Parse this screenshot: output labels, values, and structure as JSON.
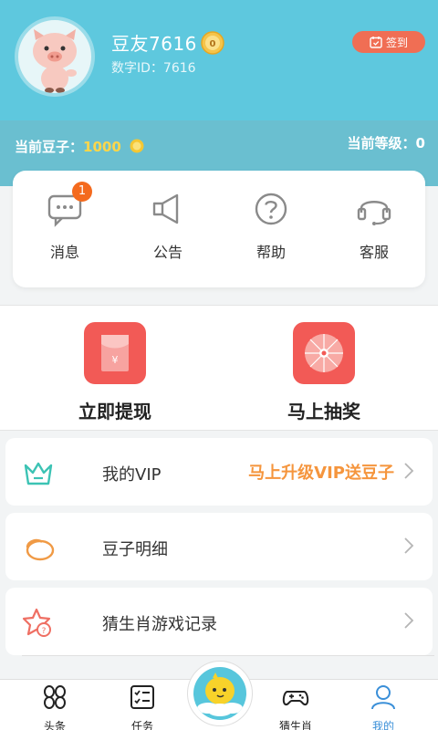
{
  "profile": {
    "username": "豆友7616",
    "level_badge_text": "0",
    "user_id": "数字ID：7616",
    "signin_label": "签到"
  },
  "stats": {
    "beans_label": "当前豆子：",
    "beans_value": "1000",
    "level_label": "当前等级：0"
  },
  "quick_actions": [
    {
      "label": "消息",
      "icon": "message-icon",
      "badge": "1"
    },
    {
      "label": "公告",
      "icon": "megaphone-icon"
    },
    {
      "label": "帮助",
      "icon": "help-icon"
    },
    {
      "label": "客服",
      "icon": "headset-icon"
    }
  ],
  "promo": {
    "withdraw_label": "立即提现",
    "lottery_label": "马上抽奖"
  },
  "menu": [
    {
      "title": "我的VIP",
      "extra": "马上升级VIP送豆子",
      "icon": "crown-icon"
    },
    {
      "title": "豆子明细",
      "extra": "",
      "icon": "bean-icon"
    },
    {
      "title": "猜生肖游戏记录",
      "extra": "",
      "icon": "star-record-icon"
    }
  ],
  "tabs": [
    {
      "label": "头条",
      "icon": "headlines-icon"
    },
    {
      "label": "任务",
      "icon": "tasks-icon"
    },
    {
      "label": "猜生肖",
      "icon": "gamepad-icon"
    },
    {
      "label": "我的",
      "icon": "user-icon",
      "active": true
    }
  ],
  "colors": {
    "header_bg": "#5ec8de",
    "beans_bar_bg": "#6abfd0",
    "accent_orange": "#f5953d",
    "promo_red": "#f25a56",
    "active_tab": "#3a8fd8"
  }
}
